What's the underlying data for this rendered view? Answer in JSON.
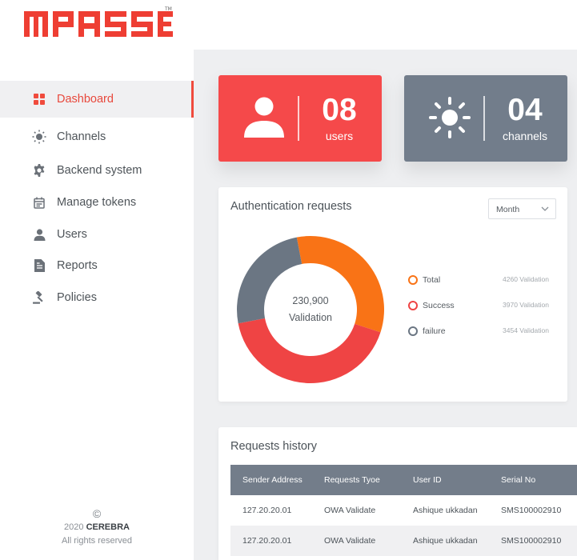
{
  "header": {
    "logo_text": "MPASS"
  },
  "sidebar": {
    "items": [
      {
        "label": "Dashboard",
        "icon": "dashboard-grid-icon",
        "active": true
      },
      {
        "label": "Channels",
        "icon": "sun-icon"
      },
      {
        "label": "Backend system",
        "icon": "gear-icon"
      },
      {
        "label": "Manage tokens",
        "icon": "calendar-icon"
      },
      {
        "label": "Users",
        "icon": "user-icon"
      },
      {
        "label": "Reports",
        "icon": "document-icon"
      },
      {
        "label": "Policies",
        "icon": "gavel-icon"
      }
    ],
    "footer": {
      "copyright_symbol": "©",
      "year": "2020",
      "company": "CEREBRA",
      "rights": "All rights reserved"
    }
  },
  "stats": {
    "users": {
      "value": "08",
      "label": "users",
      "icon": "user-icon",
      "color": "#f5494a"
    },
    "channels": {
      "value": "04",
      "label": "channels",
      "icon": "sun-icon",
      "color": "#727d8b"
    }
  },
  "auth": {
    "title": "Authentication requests",
    "period_select": "Month",
    "center_value": "230,900",
    "center_label": "Validation",
    "legend": [
      {
        "label": "Total",
        "value": "4260 Validation",
        "color": "#f97316"
      },
      {
        "label": "Success",
        "value": "3970 Validation",
        "color": "#ef4444"
      },
      {
        "label": "failure",
        "value": "3454 Validation",
        "color": "#6b7683"
      }
    ],
    "donut_fractions": {
      "orange": 0.33,
      "red": 0.42,
      "gray": 0.25
    }
  },
  "history": {
    "title": "Requests history",
    "columns": [
      "Sender Address",
      "Requests Tyoe",
      "User ID",
      "Serial No"
    ],
    "rows": [
      [
        "127.20.20.01",
        "OWA Validate",
        "Ashique ukkadan",
        "SMS100002910"
      ],
      [
        "127.20.20.01",
        "OWA Validate",
        "Ashique ukkadan",
        "SMS100002910"
      ]
    ]
  }
}
